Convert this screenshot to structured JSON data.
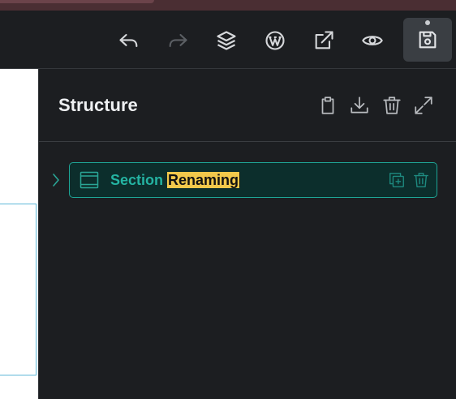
{
  "toolbar": {
    "buttons": [
      {
        "icon": "undo-icon",
        "enabled": true
      },
      {
        "icon": "redo-icon",
        "enabled": false
      },
      {
        "icon": "layers-icon",
        "enabled": true
      },
      {
        "icon": "wordpress-icon",
        "enabled": true
      },
      {
        "icon": "external-link-icon",
        "enabled": true
      },
      {
        "icon": "eye-icon",
        "enabled": true
      },
      {
        "icon": "save-icon",
        "enabled": true
      }
    ]
  },
  "structure_panel": {
    "title": "Structure",
    "header_actions": [
      "clipboard-icon",
      "download-icon",
      "trash-icon",
      "expand-icon"
    ],
    "tree": [
      {
        "type": "section",
        "icon": "section-icon",
        "label_prefix": "Section ",
        "label_highlight": "Renaming",
        "state": "editing",
        "actions": [
          "duplicate-icon",
          "trash-icon"
        ]
      }
    ]
  },
  "colors": {
    "accent": "#24b3a2",
    "highlight": "#f2c84b",
    "background": "#1c1e21"
  }
}
